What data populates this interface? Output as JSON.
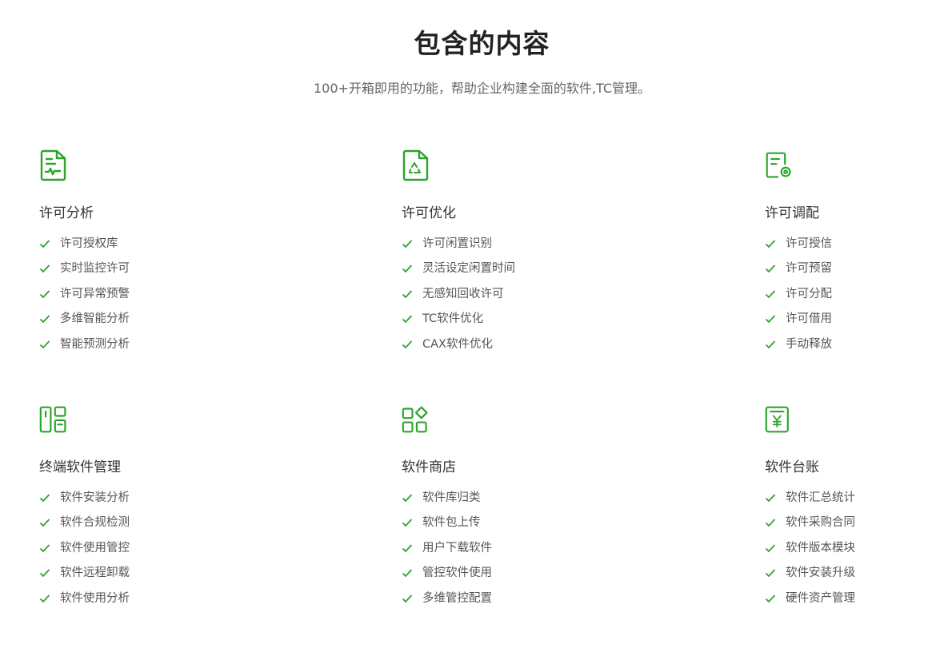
{
  "header": {
    "title": "包含的内容",
    "subtitle": "100+开箱即用的功能，帮助企业构建全面的软件,TC管理。"
  },
  "colors": {
    "accent": "#2aa52a",
    "title": "#222222",
    "text": "#555555"
  },
  "cards": [
    {
      "icon": "license-analysis-icon",
      "title": "许可分析",
      "items": [
        "许可授权库",
        "实时监控许可",
        "许可异常预警",
        "多维智能分析",
        "智能预测分析"
      ]
    },
    {
      "icon": "recycle-document-icon",
      "title": "许可优化",
      "items": [
        "许可闲置识别",
        "灵活设定闲置时间",
        "无感知回收许可",
        "TC软件优化",
        "CAX软件优化"
      ]
    },
    {
      "icon": "document-settings-icon",
      "title": "许可调配",
      "items": [
        "许可授信",
        "许可预留",
        "许可分配",
        "许可借用",
        "手动释放"
      ]
    },
    {
      "icon": "layout-panels-icon",
      "title": "终端软件管理",
      "items": [
        "软件安装分析",
        "软件合规检测",
        "软件使用管控",
        "软件远程卸载",
        "软件使用分析"
      ]
    },
    {
      "icon": "app-store-icon",
      "title": "软件商店",
      "items": [
        "软件库归类",
        "软件包上传",
        "用户下载软件",
        "管控软件使用",
        "多维管控配置"
      ]
    },
    {
      "icon": "yuan-ledger-icon",
      "title": "软件台账",
      "items": [
        "软件汇总统计",
        "软件采购合同",
        "软件版本模块",
        "软件安装升级",
        "硬件资产管理"
      ]
    }
  ]
}
